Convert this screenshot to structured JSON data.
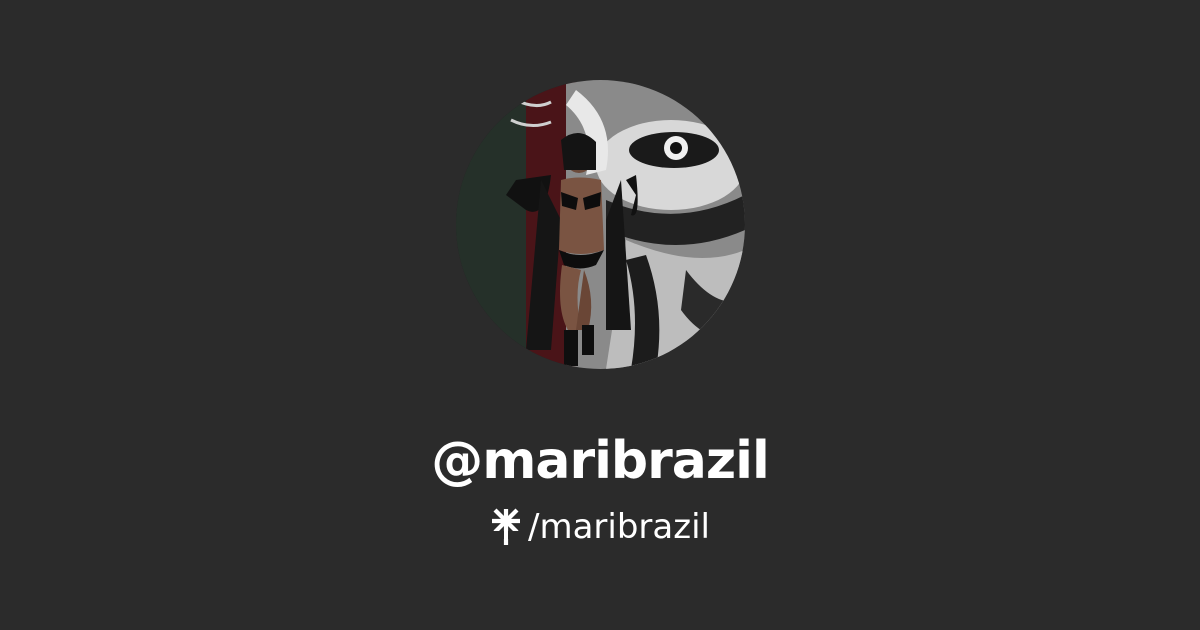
{
  "profile": {
    "handle": "@maribrazil",
    "link_path": "/maribrazil",
    "avatar_icon": "profile-photo",
    "logo_icon": "linktree-asterisk-icon"
  },
  "colors": {
    "background": "#2b2b2b",
    "text": "#ffffff"
  }
}
